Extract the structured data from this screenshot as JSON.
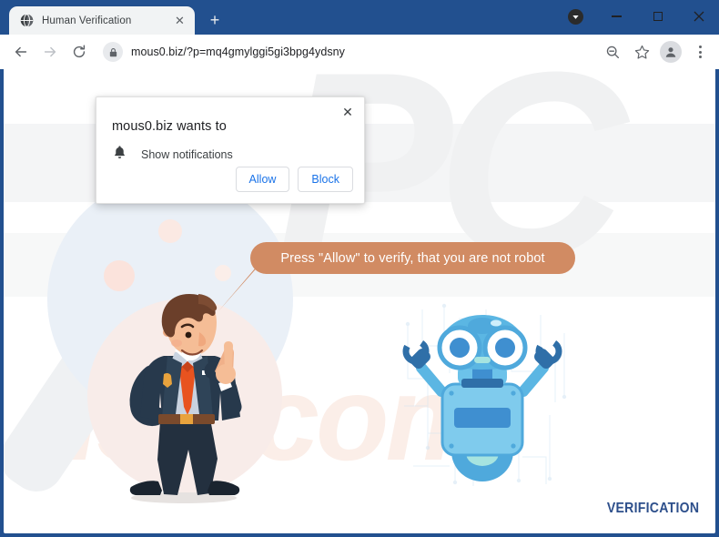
{
  "window": {
    "controls": {
      "badge_icon": "chevron-down-badge-icon",
      "minimize_label": "–",
      "maximize_label": "□",
      "close_label": "✕"
    }
  },
  "tabstrip": {
    "tabs": [
      {
        "favicon": "globe-icon",
        "title": "Human Verification",
        "close_label": "✕"
      }
    ],
    "new_tab_label": "+"
  },
  "toolbar": {
    "back_label": "←",
    "forward_label": "→",
    "reload_label": "↻",
    "lock_icon": "lock-icon",
    "url": "mous0.biz/?p=mq4gmylggi5gi3bpg4ydsny",
    "zoom_out_icon": "zoom-out-icon",
    "bookmark_icon": "star-icon",
    "profile_icon": "avatar-icon",
    "menu_icon": "kebab-menu-icon"
  },
  "dialog": {
    "title": "mous0.biz wants to",
    "permission_icon": "bell-icon",
    "permission_label": "Show notifications",
    "allow_label": "Allow",
    "block_label": "Block",
    "close_label": "✕"
  },
  "page": {
    "bubble_text": "Press \"Allow\" to verify, that you are not robot",
    "bubble_color": "#d18b63",
    "footer_text": "VERIFICATION",
    "footer_color": "#2d4f8b",
    "watermark_top": "PC",
    "watermark_bottom": "risk.com",
    "illustrations": {
      "man": "businessman-pointing-illustration",
      "robot": "blue-robot-illustration"
    }
  }
}
